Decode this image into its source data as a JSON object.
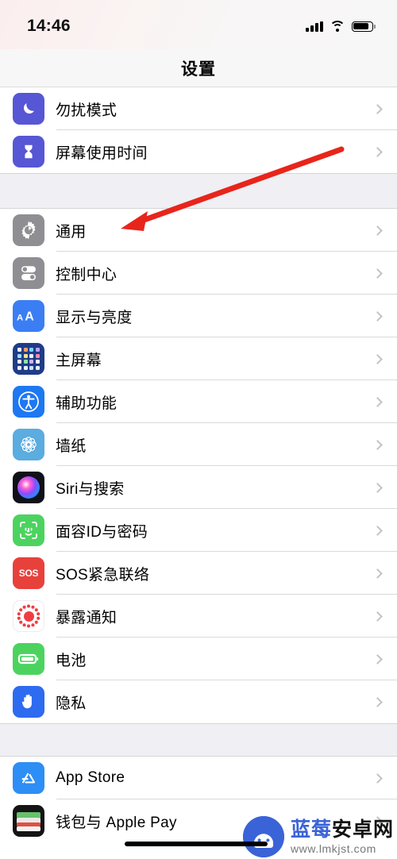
{
  "status_bar": {
    "time": "14:46",
    "signal_icon": "cellular-signal-icon",
    "wifi_icon": "wifi-icon",
    "battery_icon": "battery-icon",
    "battery_level": 74
  },
  "nav": {
    "title": "设置"
  },
  "sections": [
    {
      "id": "focus",
      "rows": [
        {
          "label": "勿扰模式",
          "icon": "moon-icon",
          "icon_class": "ic-dnd"
        },
        {
          "label": "屏幕使用时间",
          "icon": "hourglass-icon",
          "icon_class": "ic-screen"
        }
      ]
    },
    {
      "id": "system",
      "rows": [
        {
          "label": "通用",
          "icon": "gear-icon",
          "icon_class": "ic-general"
        },
        {
          "label": "控制中心",
          "icon": "toggles-icon",
          "icon_class": "ic-control"
        },
        {
          "label": "显示与亮度",
          "icon": "aa-text-icon",
          "icon_class": "ic-display"
        },
        {
          "label": "主屏幕",
          "icon": "app-grid-icon",
          "icon_class": "ic-home"
        },
        {
          "label": "辅助功能",
          "icon": "accessibility-icon",
          "icon_class": "ic-access"
        },
        {
          "label": "墙纸",
          "icon": "flower-icon",
          "icon_class": "ic-wall"
        },
        {
          "label": "Siri与搜索",
          "icon": "siri-orb-icon",
          "icon_class": "ic-siri"
        },
        {
          "label": "面容ID与密码",
          "icon": "face-id-icon",
          "icon_class": "ic-faceid"
        },
        {
          "label": "SOS紧急联络",
          "icon": "sos-icon",
          "icon_class": "ic-sos",
          "icon_text": "SOS"
        },
        {
          "label": "暴露通知",
          "icon": "exposure-notification-icon",
          "icon_class": "ic-exposure"
        },
        {
          "label": "电池",
          "icon": "battery-icon",
          "icon_class": "ic-battery"
        },
        {
          "label": "隐私",
          "icon": "hand-icon",
          "icon_class": "ic-privacy"
        }
      ]
    },
    {
      "id": "stores",
      "rows": [
        {
          "label": "App Store",
          "icon": "app-store-icon",
          "icon_class": "ic-appstore"
        },
        {
          "label": "钱包与 Apple Pay",
          "icon": "wallet-icon",
          "icon_class": "ic-wallet"
        }
      ]
    }
  ],
  "annotation": {
    "arrow_color": "#e8251b",
    "target_row_label": "通用"
  },
  "watermark": {
    "name_blue": "蓝莓",
    "name_dark": "安卓网",
    "url": "www.lmkjst.com",
    "logo_icon": "android-head-logo"
  },
  "chevron_icon": "chevron-right-icon"
}
